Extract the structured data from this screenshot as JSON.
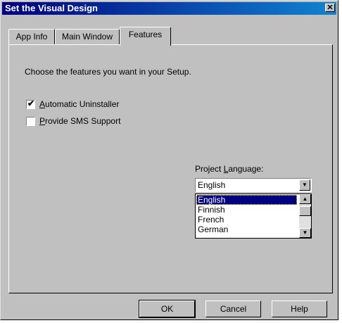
{
  "window": {
    "title": "Set the Visual Design",
    "close_glyph": "✕"
  },
  "tabs": [
    {
      "label": "App Info"
    },
    {
      "label": "Main Window"
    },
    {
      "label": "Features",
      "active": true
    }
  ],
  "features": {
    "instruction": "Choose the features you want in your Setup.",
    "options": [
      {
        "label_prefix": "",
        "accel": "A",
        "label_rest": "utomatic Uninstaller",
        "checked": true
      },
      {
        "label_prefix": "",
        "accel": "P",
        "label_rest": "rovide SMS Support",
        "checked": false
      }
    ]
  },
  "language": {
    "label_prefix": "Project ",
    "label_accel": "L",
    "label_rest": "anguage:",
    "selected": "English",
    "options": [
      "English",
      "Finnish",
      "French",
      "German"
    ]
  },
  "buttons": {
    "ok": "OK",
    "cancel": "Cancel",
    "help": "Help"
  },
  "icons": {
    "check": "✔",
    "down_arrow": "▼",
    "up_arrow": "▲"
  }
}
